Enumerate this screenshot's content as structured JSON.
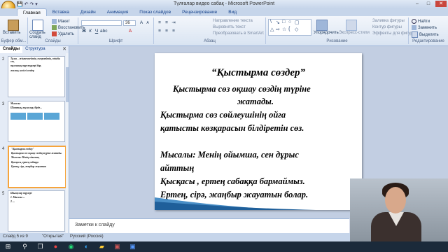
{
  "window": {
    "title": "Түлғалар видео сабақ - Microsoft PowerPoint"
  },
  "qat": {
    "icons": "💾 ↶ ↷ ▾"
  },
  "ribbon_tabs": [
    "Главная",
    "Вставка",
    "Дизайн",
    "Анимация",
    "Показ слайдов",
    "Рецензирование",
    "Вид"
  ],
  "ribbon": {
    "clipboard": {
      "paste": "Вставить",
      "label": "Буфер обм..."
    },
    "slides": {
      "create": "Создать слайд",
      "layout": "Макет",
      "restore": "Восстановить",
      "delete": "Удалить",
      "label": "Слайды"
    },
    "font": {
      "size": "36",
      "label": "Шрифт"
    },
    "paragraph": {
      "text_direction": "Направление текста",
      "align_text": "Выровнять текст",
      "smartart": "Преобразовать в SmartArt",
      "label": "Абзац"
    },
    "drawing": {
      "arrange": "Упорядочить",
      "quick_styles": "Экспресс-стили",
      "fill": "Заливка фигуры",
      "outline": "Контур фигуры",
      "effects": "Эффекты для фигур",
      "label": "Рисование"
    },
    "editing": {
      "find": "Найти",
      "replace": "Заменить",
      "select": "Выделить",
      "label": "Редактирование"
    }
  },
  "left_pane": {
    "tab_slides": "Слайды",
    "tab_outline": "Структура",
    "thumbs": [
      {
        "num": "2",
        "lines": [
          "Тұлға – жіктелмейтін, өзгермейтін, өзіндік сөз,",
          "тұлғаның түр-түрлері бар,",
          "жалпы, негізгі сөздер"
        ]
      },
      {
        "num": "3",
        "lines": [
          "Мысалы:",
          "Шаттық, тұлғалар, бірде..."
        ]
      },
      {
        "num": "4",
        "lines": [
          "\"Қыстырма сөздер\"",
          "Қыстырма сөз оқшау сөздің түріне жатады.",
          "Мысалы: Менің ойымша,",
          "Қысқасы, ертең сабаққа",
          "Ертең, сірә, жаңбыр жауатын"
        ]
      },
      {
        "num": "5",
        "lines": [
          "Шылаулар түрлері",
          "1. Мысалы ...",
          "2. ..."
        ]
      }
    ]
  },
  "slide": {
    "title": "“Қыстырма  сөздер”",
    "lines": [
      "Қыстырма сөз оқшау сөздің түріне",
      "жатады.",
      "Қыстырма  сөз сөйлеушінің  ойға",
      "қатысты көзқарасын білдіретін сөз.",
      "",
      "Мысалы: Менің ойымша, сен дұрыс",
      "айттың",
      "Қысқасы , ертең сабаққа бармаймыз.",
      "Ертең, сірә, жаңбыр жауатын болар."
    ]
  },
  "notes": {
    "placeholder": "Заметки к слайду"
  },
  "status": {
    "slide": "Слайд 5 из 9",
    "theme": "\"Открытая\"",
    "lang": "Русский (Россия)"
  },
  "colors": {
    "accent": "#f6a43c",
    "ribbon": "#dfe9f5",
    "swoosh": "#4a8fc7"
  }
}
